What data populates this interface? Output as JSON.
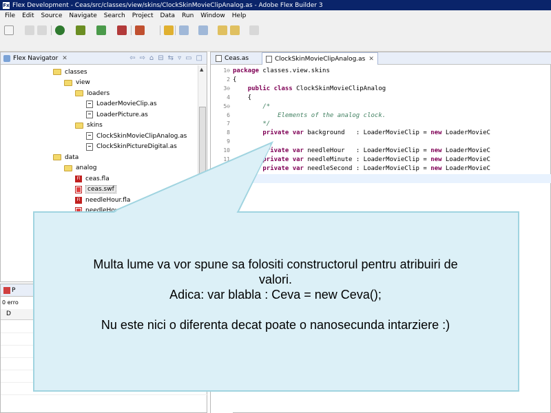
{
  "window": {
    "title": "Flex Development - Ceas/src/classes/view/skins/ClockSkinMovieClipAnalog.as - Adobe Flex Builder 3",
    "app_icon_label": "Fx"
  },
  "menu": [
    "File",
    "Edit",
    "Source",
    "Navigate",
    "Search",
    "Project",
    "Data",
    "Run",
    "Window",
    "Help"
  ],
  "navigator": {
    "tab_label": "Flex Navigator",
    "tab_close": "✕",
    "tree": [
      {
        "label": "classes",
        "icon": "folder",
        "level": 0
      },
      {
        "label": "view",
        "icon": "folder",
        "level": 1
      },
      {
        "label": "loaders",
        "icon": "folder",
        "level": 2
      },
      {
        "label": "LoaderMovieClip.as",
        "icon": "as-file",
        "level": 3
      },
      {
        "label": "LoaderPicture.as",
        "icon": "as-file",
        "level": 3
      },
      {
        "label": "skins",
        "icon": "folder",
        "level": 2
      },
      {
        "label": "ClockSkinMovieClipAnalog.as",
        "icon": "as-file",
        "level": 3
      },
      {
        "label": "ClockSkinPictureDigital.as",
        "icon": "as-file",
        "level": 3
      },
      {
        "label": "data",
        "icon": "folder",
        "level": 0
      },
      {
        "label": "analog",
        "icon": "folder",
        "level": 1
      },
      {
        "label": "ceas.fla",
        "icon": "fla-file",
        "level": 2
      },
      {
        "label": "ceas.swf",
        "icon": "swf-file",
        "level": 2,
        "selected": true
      },
      {
        "label": "needleHour.fla",
        "icon": "fla-file",
        "level": 2
      },
      {
        "label": "needleHour.sw",
        "icon": "swf-file",
        "level": 2
      }
    ]
  },
  "problems": {
    "tab_label": "P",
    "count_text": "0 erro",
    "column": "D"
  },
  "editor": {
    "tabs": [
      {
        "label": "Ceas.as",
        "active": false
      },
      {
        "label": "ClockSkinMovieClipAnalog.as",
        "active": true,
        "close": "✕"
      }
    ],
    "lines": [
      {
        "num": "1⊖",
        "parts": [
          {
            "t": "package",
            "c": "kw"
          },
          {
            "t": " classes.view.skins",
            "c": "tx"
          }
        ]
      },
      {
        "num": "2",
        "parts": [
          {
            "t": "{",
            "c": "tx"
          }
        ]
      },
      {
        "num": "3⊖",
        "parts": [
          {
            "t": "    ",
            "c": "tx"
          },
          {
            "t": "public class",
            "c": "kw"
          },
          {
            "t": " ClockSkinMovieClipAnalog",
            "c": "tx"
          }
        ]
      },
      {
        "num": "4",
        "parts": [
          {
            "t": "    {",
            "c": "tx"
          }
        ]
      },
      {
        "num": "5⊖",
        "parts": [
          {
            "t": "        /*",
            "c": "cm"
          }
        ]
      },
      {
        "num": "6",
        "parts": [
          {
            "t": "            Elements of the analog clock.",
            "c": "cm"
          }
        ]
      },
      {
        "num": "7",
        "parts": [
          {
            "t": "        */",
            "c": "cm"
          }
        ]
      },
      {
        "num": "8",
        "parts": [
          {
            "t": "        ",
            "c": "tx"
          },
          {
            "t": "private var",
            "c": "kw"
          },
          {
            "t": " background   : LoaderMovieClip = ",
            "c": "tx"
          },
          {
            "t": "new",
            "c": "kw"
          },
          {
            "t": " LoaderMovieC",
            "c": "tx"
          }
        ]
      },
      {
        "num": "9",
        "parts": [
          {
            "t": "",
            "c": "tx"
          }
        ]
      },
      {
        "num": "10",
        "parts": [
          {
            "t": "        ",
            "c": "tx"
          },
          {
            "t": "private var",
            "c": "kw"
          },
          {
            "t": " needleHour   : LoaderMovieClip = ",
            "c": "tx"
          },
          {
            "t": "new",
            "c": "kw"
          },
          {
            "t": " LoaderMovieC",
            "c": "tx"
          }
        ]
      },
      {
        "num": "11",
        "parts": [
          {
            "t": "        ",
            "c": "tx"
          },
          {
            "t": "private var",
            "c": "kw"
          },
          {
            "t": " needleMinute : LoaderMovieClip = ",
            "c": "tx"
          },
          {
            "t": "new",
            "c": "kw"
          },
          {
            "t": " LoaderMovieC",
            "c": "tx"
          }
        ]
      },
      {
        "num": "12",
        "parts": [
          {
            "t": "        ",
            "c": "tx"
          },
          {
            "t": "private var",
            "c": "kw"
          },
          {
            "t": " needleSecond : LoaderMovieClip = ",
            "c": "tx"
          },
          {
            "t": "new",
            "c": "kw"
          },
          {
            "t": " LoaderMovieC",
            "c": "tx"
          }
        ]
      },
      {
        "num": "13",
        "parts": [
          {
            "t": "    }",
            "c": "tx"
          }
        ]
      }
    ]
  },
  "callout": {
    "line1": "Multa lume va vor spune sa folositi constructorul pentru atribuiri de",
    "line2": "valori.",
    "line3": "Adica: var blabla : Ceva = new Ceva();",
    "line4": "Nu este nici o diferenta decat poate o nanosecunda intarziere :)"
  },
  "colors": {
    "keyword": "#7f0055",
    "comment": "#3f7f5f",
    "callout_fill": "#dcf0f7",
    "callout_border": "#a0d4e0",
    "titlebar": "#0a246a"
  }
}
